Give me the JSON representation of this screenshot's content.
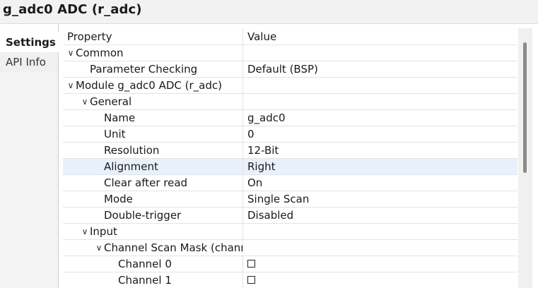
{
  "window": {
    "title": "g_adc0 ADC (r_adc)"
  },
  "tabs": [
    {
      "label": "Settings",
      "active": true
    },
    {
      "label": "API Info",
      "active": false
    }
  ],
  "table": {
    "header": {
      "property": "Property",
      "value": "Value"
    },
    "rows": [
      {
        "label": "Common",
        "value": "",
        "level": 0,
        "expandable": true,
        "expanded": true
      },
      {
        "label": "Parameter Checking",
        "value": "Default (BSP)",
        "level": 1,
        "expandable": false
      },
      {
        "label": "Module g_adc0 ADC (r_adc)",
        "value": "",
        "level": 0,
        "expandable": true,
        "expanded": true
      },
      {
        "label": "General",
        "value": "",
        "level": 1,
        "expandable": true,
        "expanded": true
      },
      {
        "label": "Name",
        "value": "g_adc0",
        "level": 2,
        "expandable": false
      },
      {
        "label": "Unit",
        "value": "0",
        "level": 2,
        "expandable": false
      },
      {
        "label": "Resolution",
        "value": "12-Bit",
        "level": 2,
        "expandable": false
      },
      {
        "label": "Alignment",
        "value": "Right",
        "level": 2,
        "expandable": false,
        "selected": true
      },
      {
        "label": "Clear after read",
        "value": "On",
        "level": 2,
        "expandable": false
      },
      {
        "label": "Mode",
        "value": "Single Scan",
        "level": 2,
        "expandable": false
      },
      {
        "label": "Double-trigger",
        "value": "Disabled",
        "level": 2,
        "expandable": false
      },
      {
        "label": "Input",
        "value": "",
        "level": 1,
        "expandable": true,
        "expanded": true
      },
      {
        "label": "Channel Scan Mask (chann",
        "value": "",
        "level": 2,
        "expandable": true,
        "expanded": true
      },
      {
        "label": "Channel 0",
        "value": "☐",
        "level": 3,
        "expandable": false,
        "checkbox": true
      },
      {
        "label": "Channel 1",
        "value": "☐",
        "level": 3,
        "expandable": false,
        "checkbox": true
      }
    ]
  },
  "icons": {
    "expanded": "chevron-down-icon",
    "checkbox": "checkbox-unchecked-icon"
  },
  "colors": {
    "selected_row": "#e8f1fb",
    "title_bg": "#f2f2f2",
    "scroll_thumb": "#8a8a8a"
  }
}
